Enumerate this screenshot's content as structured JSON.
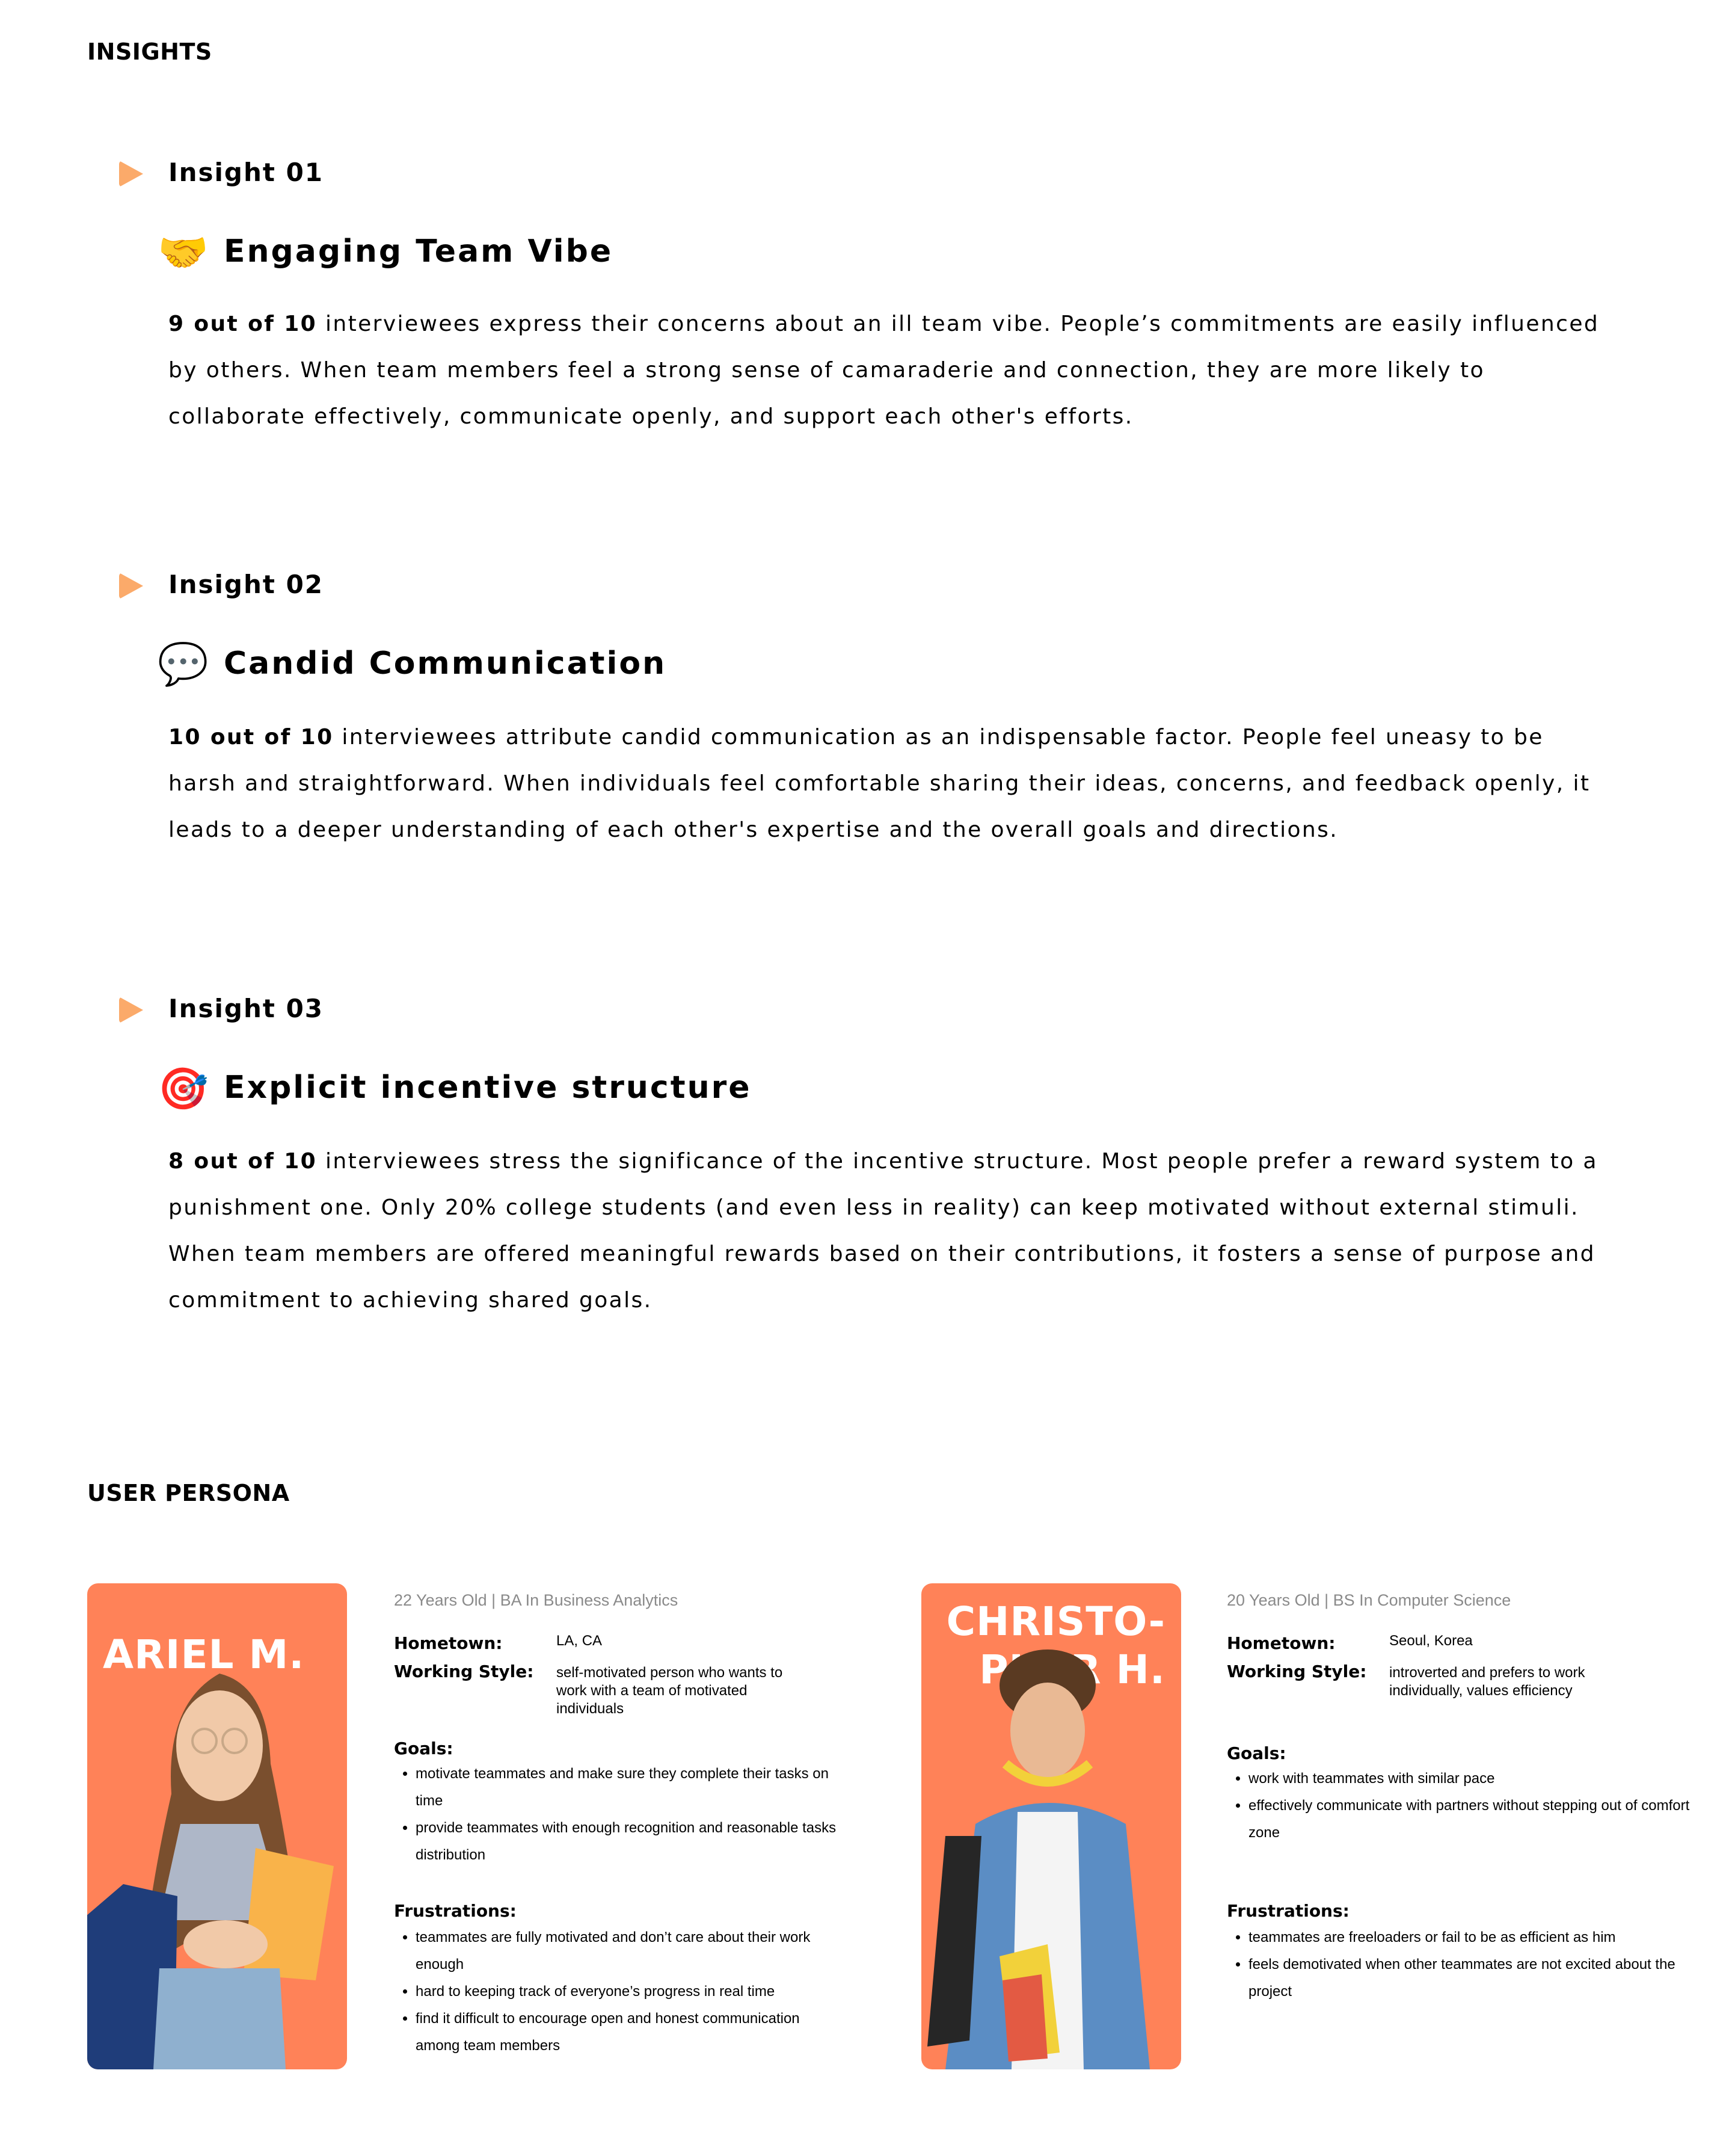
{
  "insights_title": "INSIGHTS",
  "insights": [
    {
      "label": "Insight 01",
      "emoji": "🤝",
      "emoji_name": "handshake-icon",
      "heading": "Engaging Team Vibe",
      "stat": "9 out of 10",
      "text": " interviewees express their concerns about an ill team vibe. People’s commitments are easily influenced by others. When team members feel a strong sense of camaraderie and connection, they are more likely to collaborate effectively, communicate openly, and support each other's efforts."
    },
    {
      "label": "Insight 02",
      "emoji": "💬",
      "emoji_name": "speech-bubble-icon",
      "heading": "Candid Communication",
      "stat": "10 out of 10",
      "text": " interviewees attribute candid communication as an indispensable factor. People feel uneasy to be harsh and straightforward. When individuals feel comfortable sharing their ideas, concerns, and feedback openly, it leads to a deeper understanding of each other's expertise and the overall goals and directions."
    },
    {
      "label": "Insight 03",
      "emoji": "🎯",
      "emoji_name": "target-icon",
      "heading": "Explicit incentive structure",
      "stat": "8 out of 10",
      "text": " interviewees stress the significance of the incentive structure. Most people prefer a reward system to a punishment one. Only 20% college students (and even less in reality) can keep motivated without external stimuli. When team members are offered meaningful rewards based on their contributions, it fosters a sense of purpose and commitment to achieving shared goals."
    }
  ],
  "persona_title": "USER PERSONA",
  "personas": [
    {
      "name": "ARIEL M.",
      "meta": "22 Years Old | BA In Business Analytics",
      "hometown_label": "Hometown:",
      "hometown": "LA, CA",
      "style_label": "Working Style:",
      "style": "self-motivated person who wants to work with a team of motivated individuals",
      "goals_label": "Goals:",
      "goals": [
        "motivate teammates and make sure they complete their tasks on time",
        "provide teammates with enough recognition and reasonable tasks distribution"
      ],
      "frustrations_label": "Frustrations:",
      "frustrations": [
        "teammates are fully motivated and don’t care about their work enough",
        "hard to keeping track of everyone’s progress in real time",
        "find it difficult to encourage open and honest communication among team members"
      ]
    },
    {
      "name": "CHRISTO-PHER H.",
      "name_line1": "CHRISTO-",
      "name_line2": "PHER H.",
      "meta": "20 Years Old | BS In Computer Science",
      "hometown_label": "Hometown:",
      "hometown": "Seoul, Korea",
      "style_label": "Working Style:",
      "style": "introverted and prefers to work individually, values efficiency",
      "goals_label": "Goals:",
      "goals": [
        "work with teammates with similar pace",
        "effectively communicate with partners without stepping out of comfort zone"
      ],
      "frustrations_label": "Frustrations:",
      "frustrations": [
        "teammates are freeloaders or fail to be as efficient as him",
        "feels demotivated when other teammates are not excited about the project"
      ]
    }
  ],
  "colors": {
    "accent": "#FF8258",
    "play": "#FBAA6A"
  }
}
